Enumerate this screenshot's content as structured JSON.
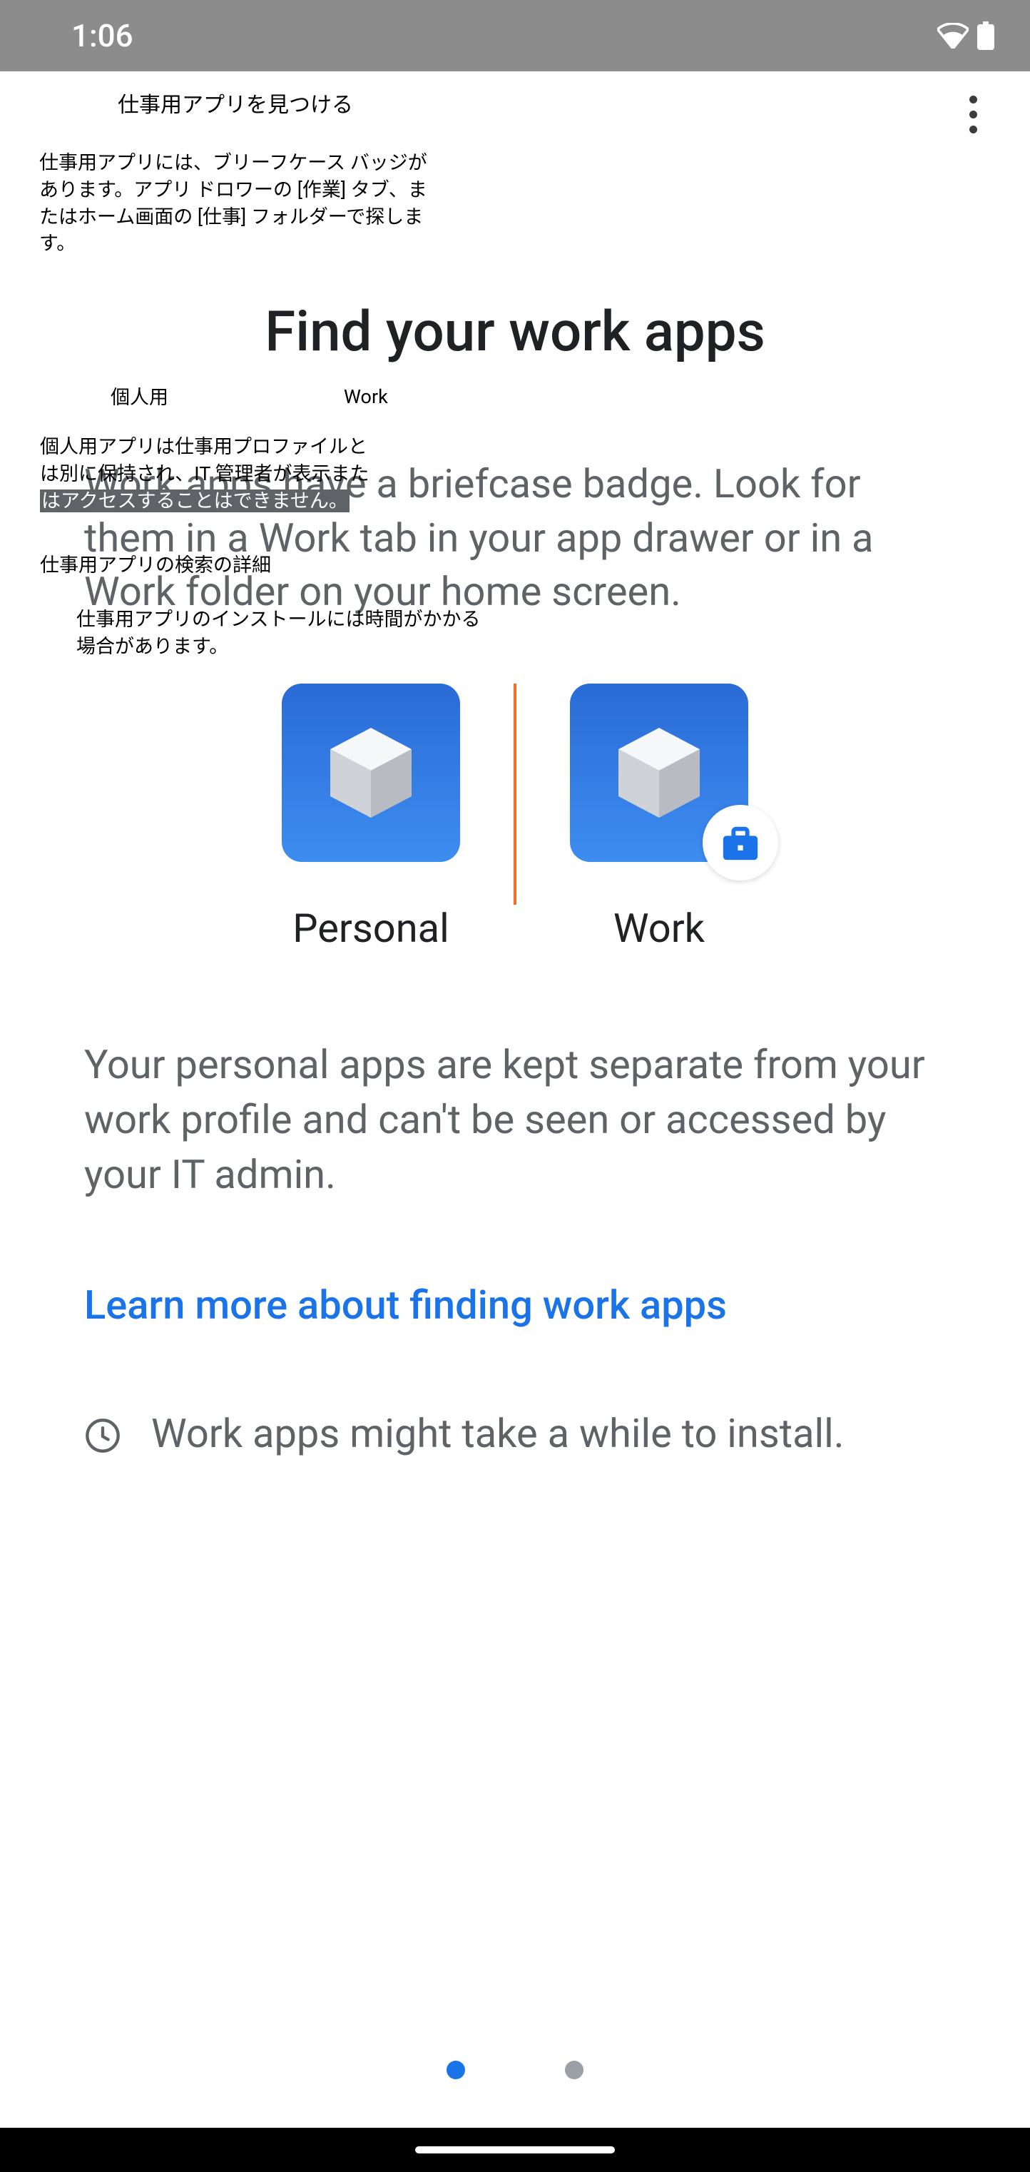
{
  "status": {
    "time": "1:06"
  },
  "jp": {
    "title": "仕事用アプリを見つける",
    "subtitle": "仕事用アプリには、ブリーフケース バッジがあります。アプリ ドロワーの [作業] タブ、またはホーム画面の [仕事] フォルダーで探します。",
    "personal_label": "個人用",
    "work_label": "Work",
    "personal_desc_line1": "個人用アプリは仕事用プロファイルと",
    "personal_desc_line2": "は別に保持され、IT 管理者が表示また",
    "personal_desc_line3": "はアクセスすることはできません。",
    "learn_more": "仕事用アプリの検索の詳細",
    "install_note": "仕事用アプリのインストールには時間がかかる場合があります。"
  },
  "en": {
    "headline": "Find your work apps",
    "body": "Work apps have a briefcase badge. Look for them in a Work tab in your app drawer or in a Work folder on your home screen.",
    "personal_label": "Personal",
    "work_label": "Work",
    "body2": "Your personal apps are kept separate from your work profile and can't be seen or accessed by your IT admin.",
    "learn_more": "Learn more about finding work apps",
    "install_note": "Work apps might take a while to install."
  },
  "colors": {
    "accent": "#1a73e8",
    "divider": "#f2702a",
    "muted": "#5f6368"
  }
}
